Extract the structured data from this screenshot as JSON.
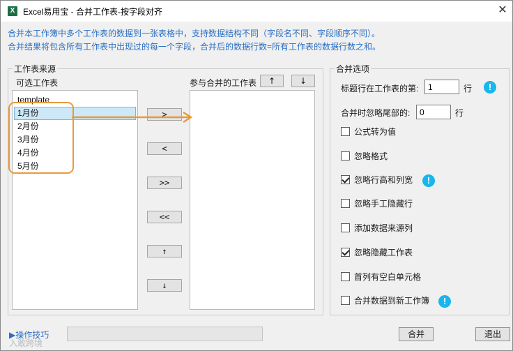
{
  "window": {
    "title": "Excel易用宝 - 合并工作表-按字段对齐",
    "app_icon": "X",
    "close_glyph": "✕"
  },
  "intro": {
    "line1": "合并本工作簿中多个工作表的数据到一张表格中，支持数据结构不同（字段名不同、字段顺序不同）。",
    "line2": "合并结果将包含所有工作表中出现过的每一个字段，合并后的数据行数=所有工作表的数据行数之和。"
  },
  "source_group": {
    "legend": "工作表来源",
    "available_label": "可选工作表",
    "selected_label": "参与合并的工作表",
    "available_items": [
      "template",
      "1月份",
      "2月份",
      "3月份",
      "4月份",
      "5月份"
    ],
    "selected_items": [],
    "buttons": {
      "add": ">",
      "remove": "<",
      "add_all": ">>",
      "remove_all": "<<",
      "move_up": "↑",
      "move_down": "↓"
    },
    "order_up": "↑",
    "order_down": "↓"
  },
  "options_group": {
    "legend": "合并选项",
    "header_row_label": "标题行在工作表的第:",
    "header_row_value": "1",
    "header_row_unit": "行",
    "ignore_tail_label": "合并时忽略尾部的:",
    "ignore_tail_value": "0",
    "ignore_tail_unit": "行",
    "checkboxes": [
      {
        "label": "公式转为值",
        "checked": false
      },
      {
        "label": "忽略格式",
        "checked": false
      },
      {
        "label": "忽略行高和列宽",
        "checked": true
      },
      {
        "label": "忽略手工隐藏行",
        "checked": false
      },
      {
        "label": "添加数据来源列",
        "checked": false
      },
      {
        "label": "忽略隐藏工作表",
        "checked": true
      },
      {
        "label": "首列有空白单元格",
        "checked": false
      },
      {
        "label": "合并数据到新工作簿",
        "checked": false
      }
    ],
    "info_glyph": "!"
  },
  "footer": {
    "tips_label": "▶操作技巧",
    "merge_button": "合并",
    "exit_button": "退出",
    "watermark": "入敢跨境"
  },
  "colors": {
    "accent_text": "#2a6fc4",
    "highlight": "#e89a3c",
    "info_icon": "#18b6ec"
  }
}
